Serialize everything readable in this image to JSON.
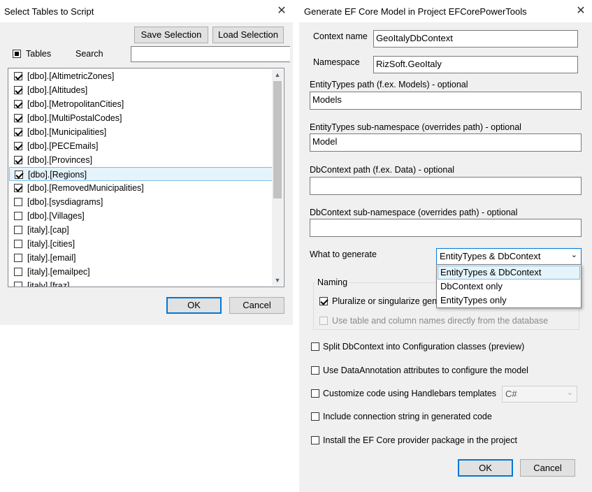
{
  "left_dialog": {
    "title": "Select Tables to Script",
    "save_selection": "Save Selection",
    "load_selection": "Load Selection",
    "tables_label": "Tables",
    "search_label": "Search",
    "search_value": "",
    "ok": "OK",
    "cancel": "Cancel",
    "items": [
      {
        "label": "[dbo].[AltimetricZones]",
        "checked": true
      },
      {
        "label": "[dbo].[Altitudes]",
        "checked": true
      },
      {
        "label": "[dbo].[MetropolitanCities]",
        "checked": true
      },
      {
        "label": "[dbo].[MultiPostalCodes]",
        "checked": true
      },
      {
        "label": "[dbo].[Municipalities]",
        "checked": true
      },
      {
        "label": "[dbo].[PECEmails]",
        "checked": true
      },
      {
        "label": "[dbo].[Provinces]",
        "checked": true
      },
      {
        "label": "[dbo].[Regions]",
        "checked": true,
        "selected": true
      },
      {
        "label": "[dbo].[RemovedMunicipalities]",
        "checked": true
      },
      {
        "label": "[dbo].[sysdiagrams]",
        "checked": false
      },
      {
        "label": "[dbo].[Villages]",
        "checked": false
      },
      {
        "label": "[italy].[cap]",
        "checked": false
      },
      {
        "label": "[italy].[cities]",
        "checked": false
      },
      {
        "label": "[italy].[email]",
        "checked": false
      },
      {
        "label": "[italy].[emailpec]",
        "checked": false
      },
      {
        "label": "[italy].[fraz]",
        "checked": false
      }
    ]
  },
  "right_dialog": {
    "title": "Generate EF Core Model in Project EFCorePowerTools",
    "context_name_label": "Context name",
    "context_name_value": "GeoItalyDbContext",
    "namespace_label": "Namespace",
    "namespace_value": "RizSoft.GeoItaly",
    "entity_path_label": "EntityTypes path (f.ex. Models) - optional",
    "entity_path_value": "Models",
    "entity_subns_label": "EntityTypes sub-namespace (overrides path) - optional",
    "entity_subns_value": "Model",
    "dbcontext_path_label": "DbContext path (f.ex. Data) - optional",
    "dbcontext_path_value": "",
    "dbcontext_subns_label": "DbContext sub-namespace (overrides path) - optional",
    "dbcontext_subns_value": "",
    "what_to_generate_label": "What to generate",
    "what_to_generate_value": "EntityTypes & DbContext",
    "what_to_generate_options": [
      "EntityTypes & DbContext",
      "DbContext only",
      "EntityTypes only"
    ],
    "naming_label": "Naming",
    "pluralize_label": "Pluralize or singularize gen",
    "use_table_names_label": "Use table and column names directly from the database",
    "split_label": "Split DbContext into Configuration classes (preview)",
    "data_annotation_label": "Use DataAnnotation attributes to configure the model",
    "handlebars_label": "Customize code using Handlebars templates",
    "handlebars_lang": "C#",
    "conn_string_label": "Include connection string in generated code",
    "install_label": "Install the EF Core provider package in the project",
    "ok": "OK",
    "cancel": "Cancel"
  }
}
